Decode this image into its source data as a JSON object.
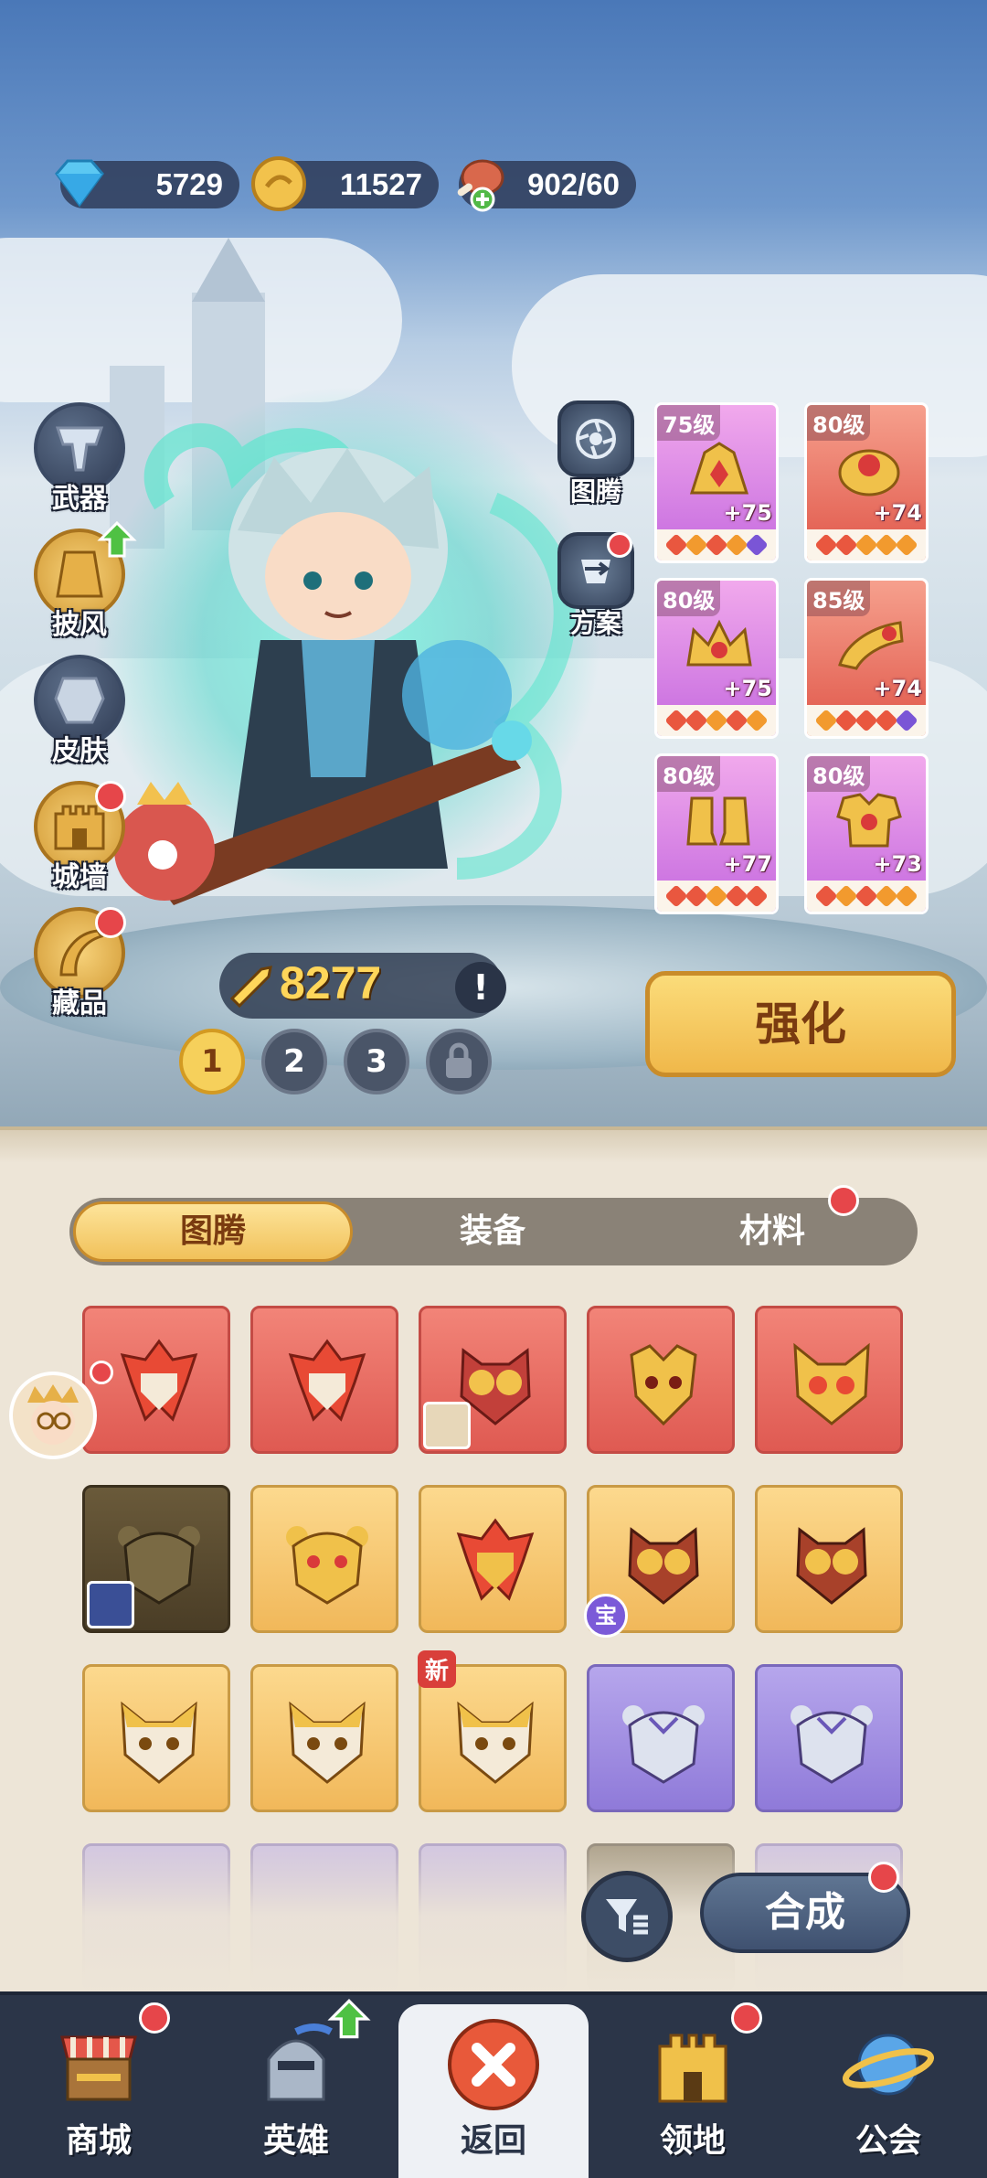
{
  "resources": {
    "gems": "5729",
    "coins": "11527",
    "stamina": "902/60"
  },
  "left_menu": [
    {
      "label": "武器",
      "icon": "weapon-icon"
    },
    {
      "label": "披风",
      "icon": "cape-icon"
    },
    {
      "label": "皮肤",
      "icon": "skin-icon"
    },
    {
      "label": "城墙",
      "icon": "wall-icon"
    },
    {
      "label": "藏品",
      "icon": "collection-icon"
    }
  ],
  "right_buttons": {
    "totem": "图腾",
    "plan": "方案"
  },
  "equipment": [
    {
      "level": "75级",
      "plus": "+75"
    },
    {
      "level": "80级",
      "plus": "+74"
    },
    {
      "level": "80级",
      "plus": "+75"
    },
    {
      "level": "85级",
      "plus": "+74"
    },
    {
      "level": "80级",
      "plus": "+77"
    },
    {
      "level": "80级",
      "plus": "+73"
    }
  ],
  "power": "8277",
  "alert_symbol": "!",
  "enhance_button": "强化",
  "pages": [
    "1",
    "2",
    "3"
  ],
  "tabs": {
    "totem": "图腾",
    "equip": "装备",
    "material": "材料"
  },
  "item_tags": {
    "new": "新",
    "treasure": "宝"
  },
  "synth_button": "合成",
  "nav": {
    "shop": "商城",
    "hero": "英雄",
    "back": "返回",
    "territory": "领地",
    "guild": "公会"
  },
  "colors": {
    "accent_gold": "#f1c15a",
    "red_dot": "#e6464a",
    "nav_bg": "#2b3548"
  }
}
